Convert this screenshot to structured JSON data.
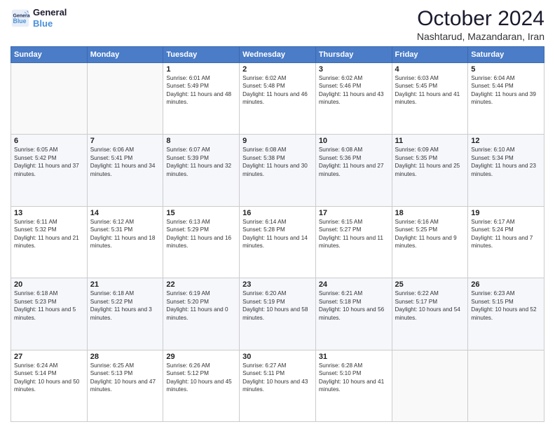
{
  "header": {
    "logo_line1": "General",
    "logo_line2": "Blue",
    "month_title": "October 2024",
    "subtitle": "Nashtarud, Mazandaran, Iran"
  },
  "weekdays": [
    "Sunday",
    "Monday",
    "Tuesday",
    "Wednesday",
    "Thursday",
    "Friday",
    "Saturday"
  ],
  "weeks": [
    [
      {
        "day": "",
        "info": ""
      },
      {
        "day": "",
        "info": ""
      },
      {
        "day": "1",
        "info": "Sunrise: 6:01 AM\nSunset: 5:49 PM\nDaylight: 11 hours and 48 minutes."
      },
      {
        "day": "2",
        "info": "Sunrise: 6:02 AM\nSunset: 5:48 PM\nDaylight: 11 hours and 46 minutes."
      },
      {
        "day": "3",
        "info": "Sunrise: 6:02 AM\nSunset: 5:46 PM\nDaylight: 11 hours and 43 minutes."
      },
      {
        "day": "4",
        "info": "Sunrise: 6:03 AM\nSunset: 5:45 PM\nDaylight: 11 hours and 41 minutes."
      },
      {
        "day": "5",
        "info": "Sunrise: 6:04 AM\nSunset: 5:44 PM\nDaylight: 11 hours and 39 minutes."
      }
    ],
    [
      {
        "day": "6",
        "info": "Sunrise: 6:05 AM\nSunset: 5:42 PM\nDaylight: 11 hours and 37 minutes."
      },
      {
        "day": "7",
        "info": "Sunrise: 6:06 AM\nSunset: 5:41 PM\nDaylight: 11 hours and 34 minutes."
      },
      {
        "day": "8",
        "info": "Sunrise: 6:07 AM\nSunset: 5:39 PM\nDaylight: 11 hours and 32 minutes."
      },
      {
        "day": "9",
        "info": "Sunrise: 6:08 AM\nSunset: 5:38 PM\nDaylight: 11 hours and 30 minutes."
      },
      {
        "day": "10",
        "info": "Sunrise: 6:08 AM\nSunset: 5:36 PM\nDaylight: 11 hours and 27 minutes."
      },
      {
        "day": "11",
        "info": "Sunrise: 6:09 AM\nSunset: 5:35 PM\nDaylight: 11 hours and 25 minutes."
      },
      {
        "day": "12",
        "info": "Sunrise: 6:10 AM\nSunset: 5:34 PM\nDaylight: 11 hours and 23 minutes."
      }
    ],
    [
      {
        "day": "13",
        "info": "Sunrise: 6:11 AM\nSunset: 5:32 PM\nDaylight: 11 hours and 21 minutes."
      },
      {
        "day": "14",
        "info": "Sunrise: 6:12 AM\nSunset: 5:31 PM\nDaylight: 11 hours and 18 minutes."
      },
      {
        "day": "15",
        "info": "Sunrise: 6:13 AM\nSunset: 5:29 PM\nDaylight: 11 hours and 16 minutes."
      },
      {
        "day": "16",
        "info": "Sunrise: 6:14 AM\nSunset: 5:28 PM\nDaylight: 11 hours and 14 minutes."
      },
      {
        "day": "17",
        "info": "Sunrise: 6:15 AM\nSunset: 5:27 PM\nDaylight: 11 hours and 11 minutes."
      },
      {
        "day": "18",
        "info": "Sunrise: 6:16 AM\nSunset: 5:25 PM\nDaylight: 11 hours and 9 minutes."
      },
      {
        "day": "19",
        "info": "Sunrise: 6:17 AM\nSunset: 5:24 PM\nDaylight: 11 hours and 7 minutes."
      }
    ],
    [
      {
        "day": "20",
        "info": "Sunrise: 6:18 AM\nSunset: 5:23 PM\nDaylight: 11 hours and 5 minutes."
      },
      {
        "day": "21",
        "info": "Sunrise: 6:18 AM\nSunset: 5:22 PM\nDaylight: 11 hours and 3 minutes."
      },
      {
        "day": "22",
        "info": "Sunrise: 6:19 AM\nSunset: 5:20 PM\nDaylight: 11 hours and 0 minutes."
      },
      {
        "day": "23",
        "info": "Sunrise: 6:20 AM\nSunset: 5:19 PM\nDaylight: 10 hours and 58 minutes."
      },
      {
        "day": "24",
        "info": "Sunrise: 6:21 AM\nSunset: 5:18 PM\nDaylight: 10 hours and 56 minutes."
      },
      {
        "day": "25",
        "info": "Sunrise: 6:22 AM\nSunset: 5:17 PM\nDaylight: 10 hours and 54 minutes."
      },
      {
        "day": "26",
        "info": "Sunrise: 6:23 AM\nSunset: 5:15 PM\nDaylight: 10 hours and 52 minutes."
      }
    ],
    [
      {
        "day": "27",
        "info": "Sunrise: 6:24 AM\nSunset: 5:14 PM\nDaylight: 10 hours and 50 minutes."
      },
      {
        "day": "28",
        "info": "Sunrise: 6:25 AM\nSunset: 5:13 PM\nDaylight: 10 hours and 47 minutes."
      },
      {
        "day": "29",
        "info": "Sunrise: 6:26 AM\nSunset: 5:12 PM\nDaylight: 10 hours and 45 minutes."
      },
      {
        "day": "30",
        "info": "Sunrise: 6:27 AM\nSunset: 5:11 PM\nDaylight: 10 hours and 43 minutes."
      },
      {
        "day": "31",
        "info": "Sunrise: 6:28 AM\nSunset: 5:10 PM\nDaylight: 10 hours and 41 minutes."
      },
      {
        "day": "",
        "info": ""
      },
      {
        "day": "",
        "info": ""
      }
    ]
  ]
}
